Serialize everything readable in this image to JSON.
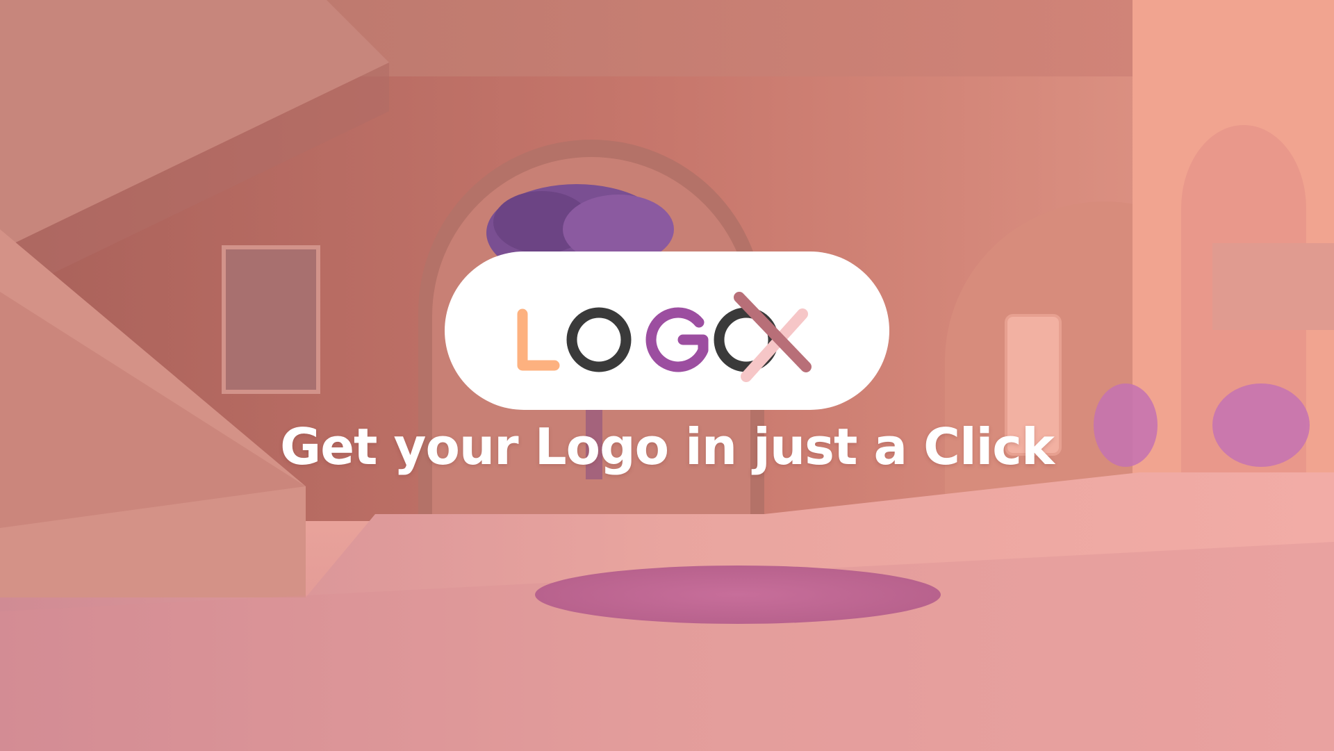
{
  "brand": {
    "name": "LOGOX",
    "letters": [
      "L",
      "O",
      "G",
      "O",
      "X"
    ]
  },
  "tagline": "Get your Logo in just a Click",
  "colors": {
    "l_orange": "#fdb17f",
    "o_dark": "#3a3a3a",
    "g_purple": "#9c4ea0",
    "x_mauve": "#b86f78",
    "x_pink": "#f6c6c7",
    "pill_bg": "#ffffff",
    "scene_base": "#d78a7b"
  },
  "icons": {
    "logo": "logox-wordmark",
    "background": "pink-3d-interior-illustration"
  }
}
